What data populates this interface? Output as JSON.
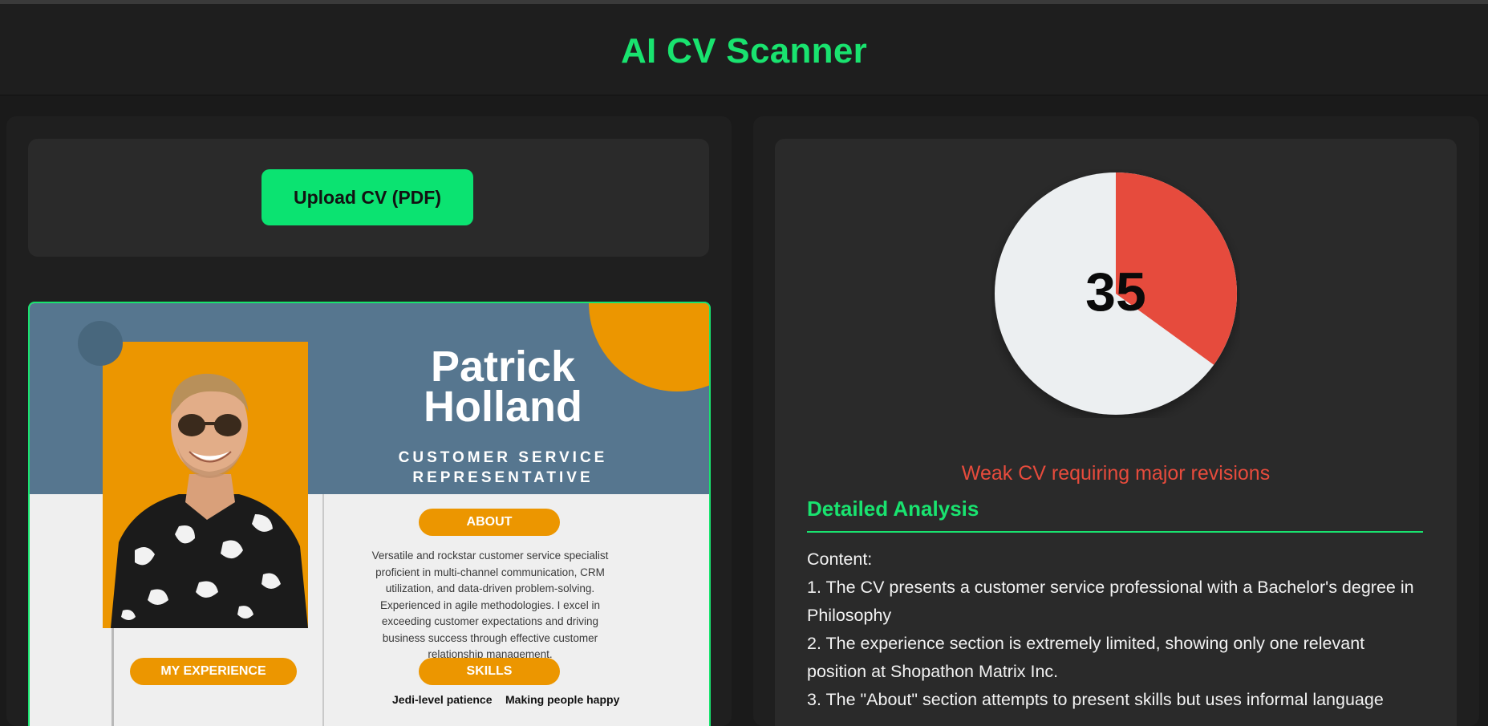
{
  "app": {
    "title": "AI CV Scanner",
    "accent_color": "#19e36f"
  },
  "upload": {
    "button_label": "Upload CV (PDF)"
  },
  "cv_preview": {
    "name_first": "Patrick",
    "name_last": "Holland",
    "role_line1": "CUSTOMER SERVICE",
    "role_line2": "REPRESENTATIVE",
    "about_label": "ABOUT",
    "about_text": "Versatile and rockstar customer service specialist proficient in multi-channel communication, CRM utilization, and data-driven problem-solving. Experienced in agile methodologies. I excel in exceeding customer expectations and driving business success through effective customer relationship management.",
    "experience_label": "MY EXPERIENCE",
    "skills_label": "SKILLS",
    "skills": [
      "Jedi-level patience",
      "Making people happy"
    ]
  },
  "score": {
    "value": "35",
    "max": 100,
    "fill_color": "#e64b3c",
    "rest_color": "#eceff1",
    "verdict": "Weak CV requiring major revisions"
  },
  "analysis": {
    "title": "Detailed Analysis",
    "lines": [
      "Content:",
      "1. The CV presents a customer service professional with a Bachelor's degree in Philosophy",
      "2. The experience section is extremely limited, showing only one relevant position at Shopathon Matrix Inc.",
      "3. The \"About\" section attempts to present skills but uses informal language"
    ]
  }
}
